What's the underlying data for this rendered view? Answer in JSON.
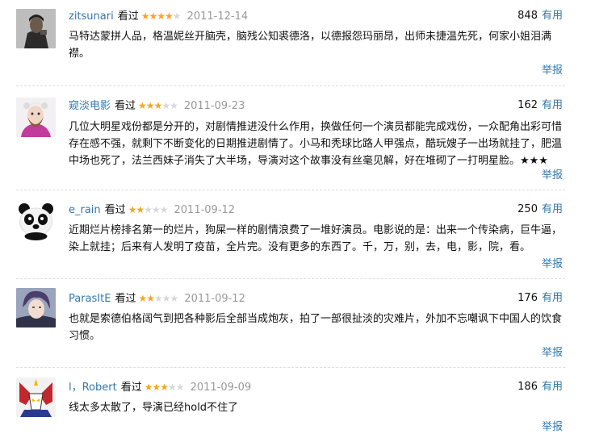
{
  "colors": {
    "link": "#3377aa",
    "star": "#f5a623",
    "date": "#999999"
  },
  "reviews": [
    {
      "user": "zitsunari",
      "status": "看过",
      "rating": 4,
      "date": "2011-12-14",
      "votes": "848",
      "useful_label": "有用",
      "content": "马特达蒙拼人品，格温妮丝开脑壳，脑残公知裘德洛，以德报怨玛丽昂，出师未捷温先死，何家小姐泪满襟。",
      "report_label": "举报",
      "avatar": "dark-portrait-avatar"
    },
    {
      "user": "窥淡电影",
      "status": "看过",
      "rating": 3,
      "date": "2011-09-23",
      "votes": "162",
      "useful_label": "有用",
      "content": "几位大明星戏份都是分开的，对剧情推进没什么作用，换做任何一个演员都能完成戏份，一众配角出彩可惜存在感不强，就剩下不断变化的日期推进剧情了。小马和秃球比路人甲强点，酷玩嫂子一出场就挂了，肥温中场也死了，法兰西妹子消失了大半场，导演对这个故事没有丝毫见解，好在堆砌了一打明星脸。★★★",
      "report_label": "举报",
      "avatar": "bearded-guy-avatar"
    },
    {
      "user": "e_rain",
      "status": "看过",
      "rating": 2,
      "date": "2011-09-12",
      "votes": "250",
      "useful_label": "有用",
      "content": "近期烂片榜排名第一的烂片，狗屎一样的剧情浪费了一堆好演员。电影说的是：出来一个传染病，巨牛逼，染上就挂；后来有人发明了疫苗，全片完。没有更多的东西了。千，万，别，去，电，影，院，看。",
      "report_label": "举报",
      "avatar": "panda-avatar"
    },
    {
      "user": "ParasItE",
      "status": "看过",
      "rating": 2,
      "date": "2011-09-12",
      "votes": "176",
      "useful_label": "有用",
      "content": "也就是索德伯格阔气到把各种影后全部当成炮灰，拍了一部很扯淡的灾难片，外加不忘嘲讽下中国人的饮食习惯。",
      "report_label": "举报",
      "avatar": "anime-character-avatar"
    },
    {
      "user": "l，Robert",
      "status": "看过",
      "rating": 3,
      "date": "2011-09-09",
      "votes": "186",
      "useful_label": "有用",
      "content": "线太多太散了，导演已经hold不住了",
      "report_label": "举报",
      "avatar": "robot-avatar"
    }
  ]
}
